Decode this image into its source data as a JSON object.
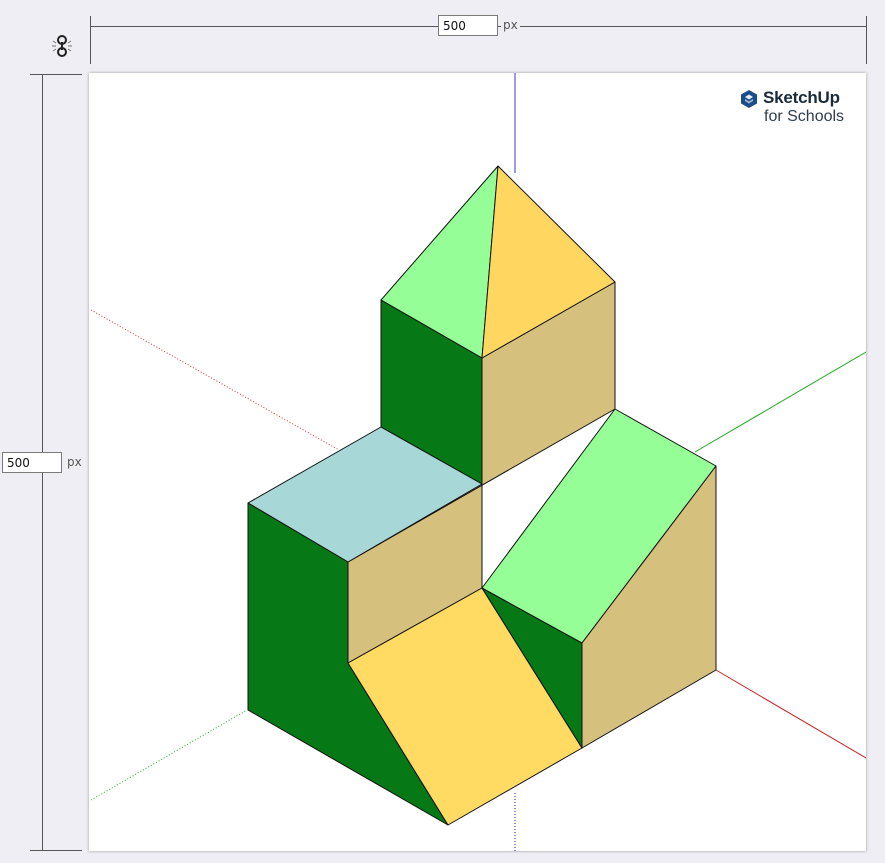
{
  "dimensions": {
    "width": {
      "value": "500",
      "unit": "px"
    },
    "height": {
      "value": "500",
      "unit": "px"
    }
  },
  "aspect_lock": {
    "icon": "unlinked-chain-icon"
  },
  "brand": {
    "line1": "SketchUp",
    "line2": "for Schools",
    "icon": "sketchup-logo-icon"
  },
  "colors": {
    "background": "#eeeef4",
    "canvas": "#ffffff",
    "dark_green": "#077816",
    "light_green": "#96fe96",
    "tan": "#d6c07e",
    "yellow": "#ffdb64",
    "light_yellow": "#ffd760",
    "blue_gray": "#a8d7d8",
    "axis_red": "#cc2222",
    "axis_green": "#22bb22",
    "axis_blue": "#2222cc"
  }
}
